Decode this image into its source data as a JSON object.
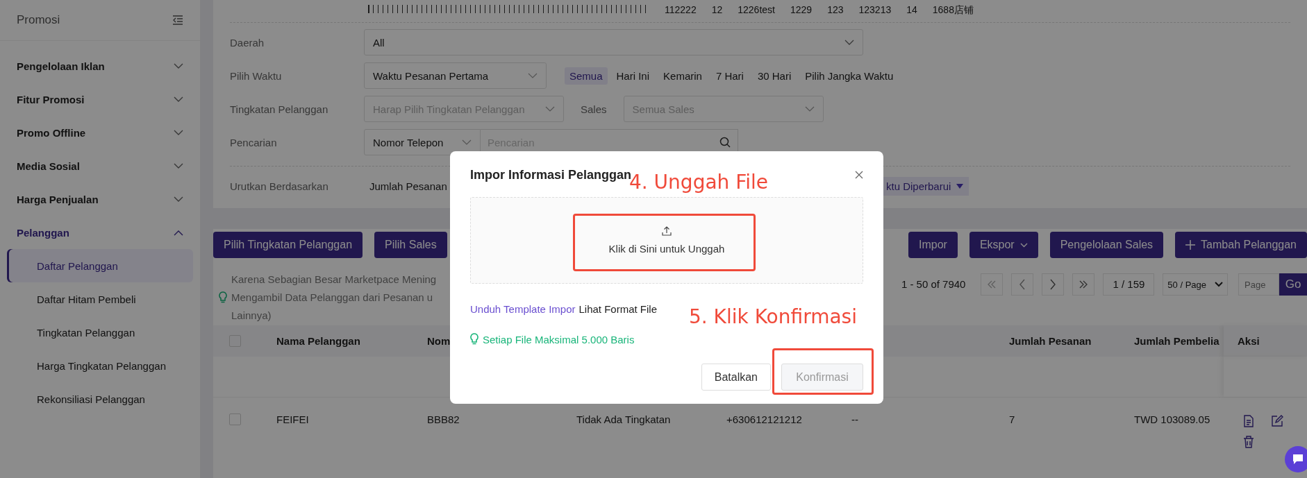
{
  "sidebar": {
    "title": "Promosi",
    "groups": [
      {
        "label": "Pengelolaan Iklan",
        "expanded": false
      },
      {
        "label": "Fitur Promosi",
        "expanded": false
      },
      {
        "label": "Promo Offline",
        "expanded": false
      },
      {
        "label": "Media Sosial",
        "expanded": false
      },
      {
        "label": "Harga Penjualan",
        "expanded": false
      },
      {
        "label": "Pelanggan",
        "expanded": true,
        "children": [
          {
            "label": "Daftar Pelanggan",
            "selected": true
          },
          {
            "label": "Daftar Hitam Pembeli",
            "selected": false
          },
          {
            "label": "Tingkatan Pelanggan",
            "selected": false
          },
          {
            "label": "Harga Tingkatan Pelanggan",
            "selected": false
          },
          {
            "label": "Rekonsiliasi Pelanggan",
            "selected": false
          }
        ]
      }
    ]
  },
  "filters": {
    "tags": [
      "112222",
      "12",
      "1226test",
      "1229",
      "123",
      "123213",
      "14",
      "1688店铺"
    ],
    "region": {
      "label": "Daerah",
      "value": "All"
    },
    "time": {
      "label": "Pilih Waktu",
      "value": "Waktu Pesanan Pertama",
      "options": [
        {
          "label": "Semua",
          "selected": true
        },
        {
          "label": "Hari Ini",
          "selected": false
        },
        {
          "label": "Kemarin",
          "selected": false
        },
        {
          "label": "7 Hari",
          "selected": false
        },
        {
          "label": "30 Hari",
          "selected": false
        },
        {
          "label": "Pilih Jangka Waktu",
          "selected": false
        }
      ]
    },
    "level": {
      "label": "Tingkatan Pelanggan",
      "placeholder": "Harap Pilih Tingkatan Pelanggan",
      "sales_label": "Sales",
      "sales_placeholder": "Semua Sales"
    },
    "search": {
      "label": "Pencarian",
      "type": "Nomor Telepon",
      "placeholder": "Pencarian"
    },
    "sort": {
      "label": "Urutkan Berdasarkan",
      "options": [
        {
          "label": "Jumlah Pesanan",
          "selected": false
        },
        {
          "label": "ktu Diperbarui",
          "selected": true
        }
      ]
    }
  },
  "toolbar": {
    "left": [
      "Pilih Tingkatan Pelanggan",
      "Pilih Sales"
    ],
    "right": [
      {
        "label": "Impor",
        "kind": "plain"
      },
      {
        "label": "Ekspor",
        "kind": "dropdown"
      },
      {
        "label": "Pengelolaan Sales",
        "kind": "plain"
      },
      {
        "label": "Tambah Pelanggan",
        "kind": "add"
      }
    ]
  },
  "notice": [
    "Karena Sebagian Besar Marketpace Mening",
    "Mengambil Data Pelanggan dari Pesanan u",
    "Lainnya)"
  ],
  "pagination": {
    "range": "1 - 50 of 7940",
    "page": "1 / 159",
    "page_size": "50 / Page",
    "jump_placeholder": "Page",
    "go": "Go"
  },
  "table": {
    "columns": [
      "Nama Pelanggan",
      "Nom",
      "",
      "",
      "",
      "Jumlah Pesanan",
      "Jumlah Pembelia",
      "Aksi"
    ],
    "all_checked": false,
    "rows": [
      {
        "checked": false,
        "cells": [
          "FEIFEI",
          "BBB82",
          "Tidak Ada Tingkatan",
          "+630612121212",
          "--",
          "7",
          "TWD 103089.05"
        ]
      }
    ]
  },
  "dialog": {
    "title": "Impor Informasi Pelanggan",
    "upload_text": "Klik di Sini untuk Unggah",
    "template_link": "Unduh Template Impor",
    "format_text": "Lihat Format File",
    "tip": "Setiap File Maksimal 5.000 Baris",
    "buttons": [
      {
        "label": "Batalkan",
        "disabled": false
      },
      {
        "label": "Konfirmasi",
        "disabled": true
      }
    ]
  },
  "annotations": [
    "4. Unggah File",
    "5. Klik Konfirmasi"
  ]
}
